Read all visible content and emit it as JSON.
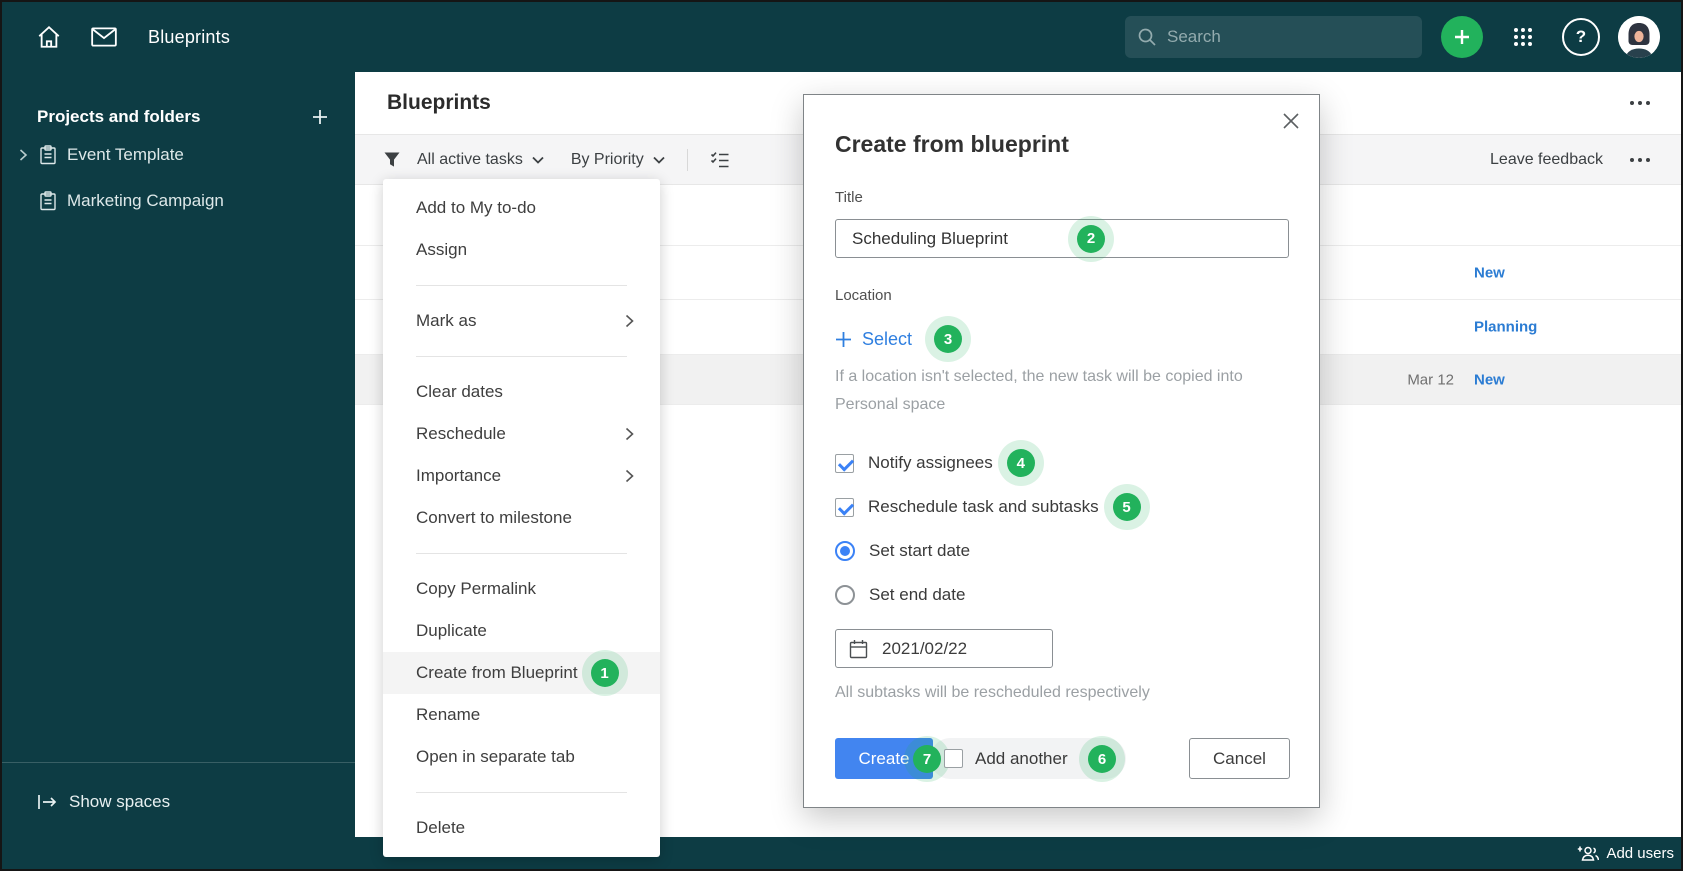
{
  "colors": {
    "teal": "#0d3c44",
    "green": "#22b25c",
    "link_blue": "#2b7cd3",
    "button_blue": "#4285f0"
  },
  "topbar": {
    "title": "Blueprints",
    "search_placeholder": "Search"
  },
  "sidebar": {
    "header": "Projects and folders",
    "items": [
      {
        "label": "Event Template"
      },
      {
        "label": "Marketing Campaign"
      }
    ],
    "footer": "Show spaces"
  },
  "main": {
    "title": "Blueprints",
    "filter_label": "All active tasks",
    "sort_label": "By Priority",
    "leave_feedback": "Leave feedback",
    "rows": [
      {
        "date": "",
        "status": ""
      },
      {
        "date": "",
        "status": "New"
      },
      {
        "date": "",
        "status": "Planning"
      },
      {
        "date": "Mar 12",
        "status": "New"
      }
    ]
  },
  "context_menu": {
    "items": [
      {
        "label": "Add to My to-do"
      },
      {
        "label": "Assign"
      },
      {
        "label": "Mark as"
      },
      {
        "label": "Clear dates"
      },
      {
        "label": "Reschedule"
      },
      {
        "label": "Importance"
      },
      {
        "label": "Convert to milestone"
      },
      {
        "label": "Copy Permalink"
      },
      {
        "label": "Duplicate"
      },
      {
        "label": "Create from Blueprint",
        "badge": "1"
      },
      {
        "label": "Rename"
      },
      {
        "label": "Open in separate tab"
      },
      {
        "label": "Delete"
      }
    ]
  },
  "modal": {
    "title": "Create from blueprint",
    "title_label": "Title",
    "title_value": "Scheduling Blueprint",
    "title_badge": "2",
    "location_label": "Location",
    "select_label": "Select",
    "select_badge": "3",
    "location_hint": "If a location isn't selected, the new task will be copied into Personal space",
    "notify_label": "Notify assignees",
    "notify_badge": "4",
    "reschedule_label": "Reschedule task and subtasks",
    "reschedule_badge": "5",
    "start_date_label": "Set start date",
    "end_date_label": "Set end date",
    "date_value": "2021/02/22",
    "date_hint": "All subtasks will be rescheduled respectively",
    "create_label": "Create",
    "create_badge": "7",
    "add_another_label": "Add another",
    "add_another_badge": "6",
    "cancel_label": "Cancel"
  },
  "bottombar": {
    "add_users": "Add users"
  }
}
